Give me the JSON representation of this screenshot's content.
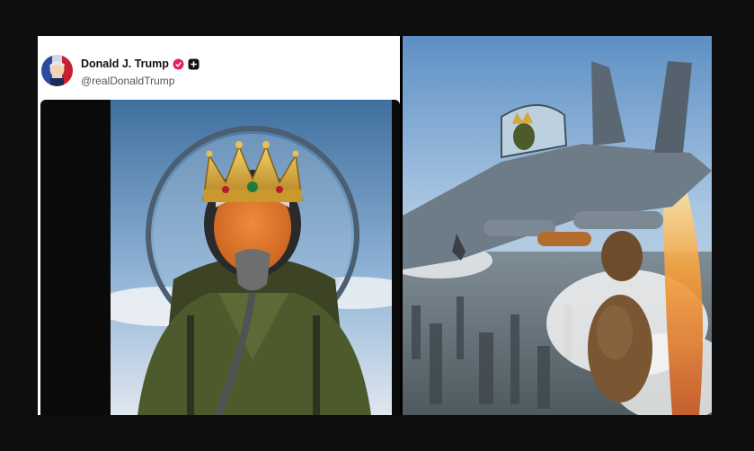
{
  "post": {
    "author_name": "Donald J. Trump",
    "handle": "@realDonaldTrump",
    "icons": {
      "avatar": "avatar-portrait-icon",
      "verified": "verified-badge-icon",
      "add": "plus-badge-icon"
    },
    "colors": {
      "verified": "#e0245e",
      "sky": "#6f9ac4",
      "flight_suit": "#4d5a2c",
      "crown": "#d4a83a"
    }
  },
  "media": {
    "left_image": "pilot-wearing-crown-in-cockpit",
    "right_image": "fighter-jet-dropping-brown-objects-over-city"
  }
}
